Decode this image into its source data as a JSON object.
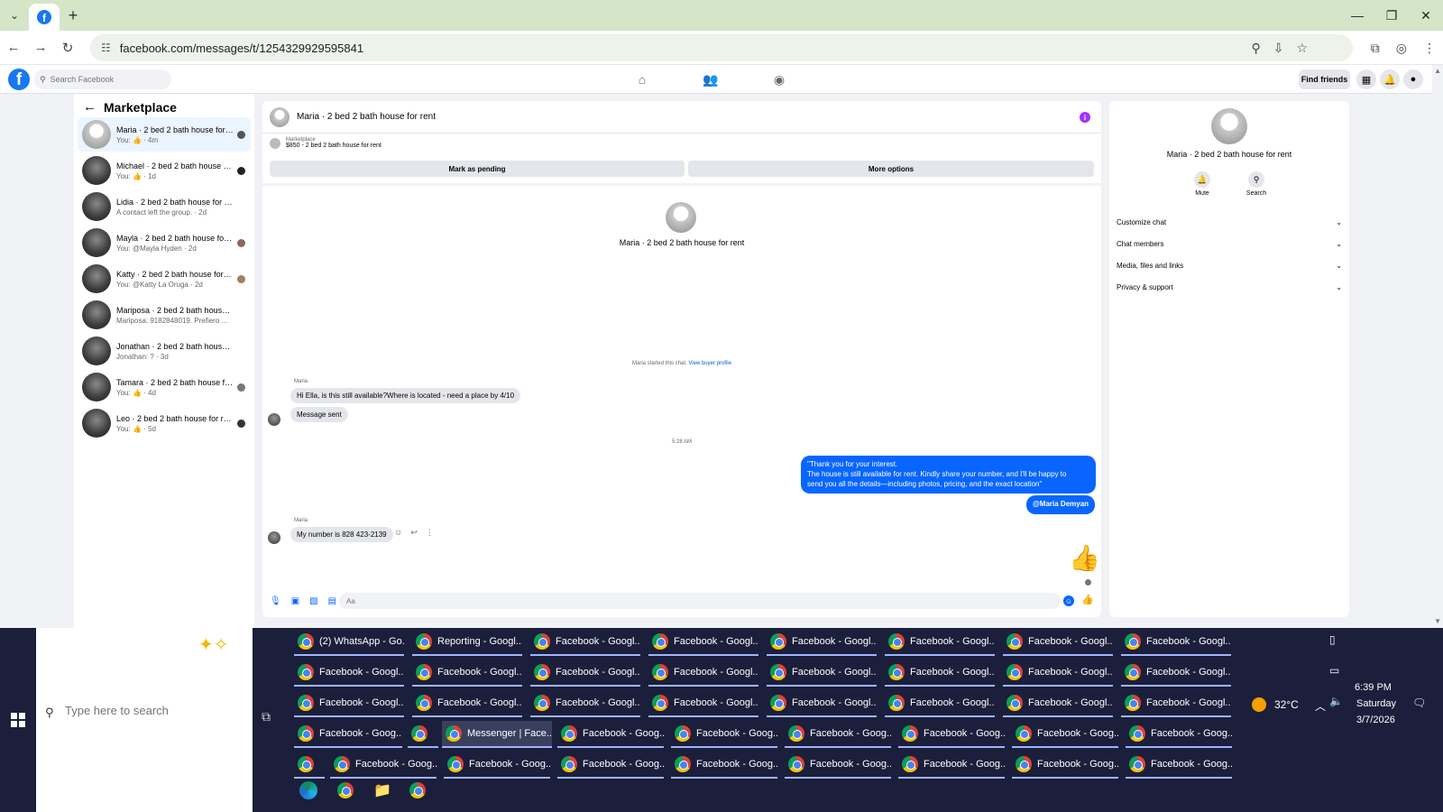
{
  "browser": {
    "url": "facebook.com/messages/t/1254329929595841"
  },
  "fb": {
    "search_placeholder": "Search Facebook",
    "find_friends": "Find friends"
  },
  "conversations": {
    "title": "Marketplace",
    "items": [
      {
        "name": "Maria · 2 bed 2 bath house for r...",
        "sub": "You: 👍 · 4m"
      },
      {
        "name": "Michael · 2 bed 2 bath house fo...",
        "sub": "You: 👍 · 1d"
      },
      {
        "name": "Lidia · 2 bed 2 bath house for rent",
        "sub": "A contact left the group. · 2d"
      },
      {
        "name": "Mayla · 2 bed 2 bath house for r...",
        "sub": "You: @Mayla Hyden · 2d"
      },
      {
        "name": "Katty · 2 bed 2 bath house for re...",
        "sub": "You: @Katty La Oruga · 2d"
      },
      {
        "name": "Mariposa · 2 bed 2 bath house for ...",
        "sub": "Mariposa: 9182848019. Prefiero mens... · 3d"
      },
      {
        "name": "Jonathan · 2 bed 2 bath house for ...",
        "sub": "Jonathan: ? · 3d"
      },
      {
        "name": "Tamara · 2 bed 2 bath house for...",
        "sub": "You: 👍 · 4d"
      },
      {
        "name": "Leo · 2 bed 2 bath house for rent",
        "sub": "You: 👍 · 5d"
      }
    ]
  },
  "chat": {
    "title": "Maria · 2 bed 2 bath house for rent",
    "listing_label": "Marketplace",
    "listing_text": "$850 - 2 bed 2 bath house for rent",
    "mark_pending": "Mark as pending",
    "more_options": "More options",
    "center_title": "Maria · 2 bed 2 bath house for rent",
    "started_text": "Maria started this chat.",
    "view_buyer": "View buyer profile",
    "sender1": "Maria",
    "msg1": "Hi Ella, is this still available?Where is located - need a place by 4/10",
    "msg2": "Message sent",
    "timestamp": "5:28 AM",
    "out_line1": "\"Thank you for your interest.",
    "out_line2": "The house is still available for rent. Kindly share your number, and I'll be happy to",
    "out_line3": "send you all the details—including photos, pricing, and the exact location\"",
    "mention": "@Maria Demyan",
    "sender2": "Maria",
    "msg3": "My number is 828 423-2139",
    "composer_placeholder": "Aa"
  },
  "details": {
    "title": "Maria · 2 bed 2 bath house for rent",
    "mute": "Mute",
    "search": "Search",
    "sections": [
      "Customize chat",
      "Chat members",
      "Media, files and links",
      "Privacy & support"
    ]
  },
  "taskbar": {
    "search_placeholder": "Type here to search",
    "buttons": [
      "(2) WhatsApp - Go...",
      "Reporting - Googl...",
      "Facebook - Googl...",
      "Facebook - Googl...",
      "Facebook - Googl...",
      "Facebook - Googl...",
      "Facebook - Googl...",
      "Facebook - Googl...",
      "Facebook - Googl...",
      "Facebook - Googl...",
      "Facebook - Googl...",
      "Facebook - Googl...",
      "Facebook - Googl...",
      "Facebook - Googl...",
      "Facebook - Googl...",
      "Facebook - Googl...",
      "Facebook - Googl...",
      "Facebook - Googl...",
      "Facebook - Googl...",
      "Facebook - Googl...",
      "Facebook - Googl...",
      "Facebook - Googl...",
      "Facebook - Googl...",
      "Facebook - Googl...",
      "Facebook - Goog...",
      "",
      "Messenger | Face...",
      "Facebook - Goog...",
      "Facebook - Goog...",
      "Facebook - Goog...",
      "Facebook - Goog...",
      "Facebook - Goog...",
      "Facebook - Goog...",
      "",
      "Facebook - Goog...",
      "Facebook - Goog...",
      "Facebook - Goog...",
      "Facebook - Goog...",
      "Facebook - Goog...",
      "Facebook - Goog...",
      "Facebook - Goog...",
      "Facebook - Goog..."
    ],
    "weather": "32°C",
    "time": "6:39 PM",
    "day": "Saturday",
    "date": "3/7/2026"
  }
}
